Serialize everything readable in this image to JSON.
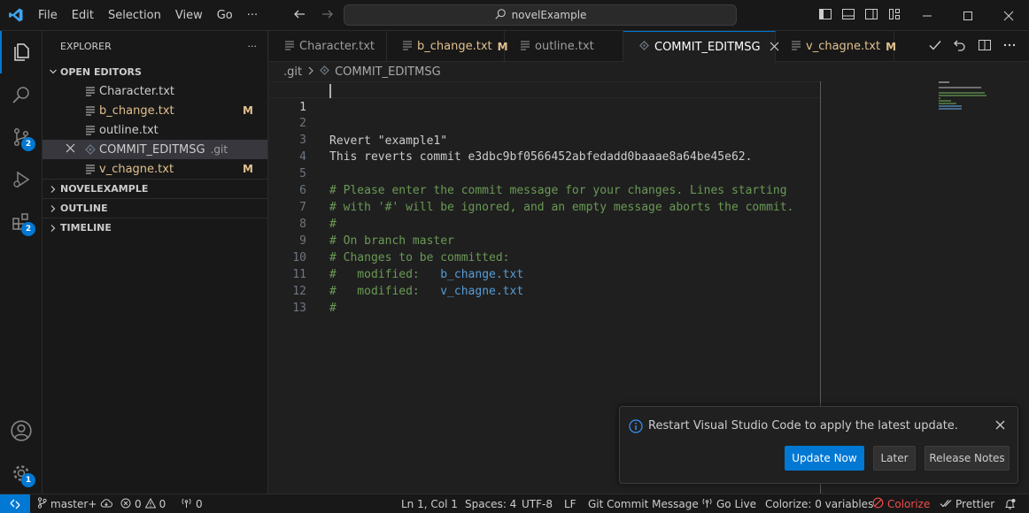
{
  "menu": [
    "File",
    "Edit",
    "Selection",
    "View",
    "Go",
    "···"
  ],
  "search": {
    "text": "novelExample"
  },
  "explorer": {
    "title": "EXPLORER",
    "more": "···",
    "open_editors": {
      "label": "OPEN EDITORS",
      "files": [
        {
          "name": "Character.txt",
          "desc": "",
          "mod": ""
        },
        {
          "name": "b_change.txt",
          "desc": "",
          "mod": "M"
        },
        {
          "name": "outline.txt",
          "desc": "",
          "mod": ""
        },
        {
          "name": "COMMIT_EDITMSG",
          "desc": ".git",
          "mod": ""
        },
        {
          "name": "v_chagne.txt",
          "desc": "",
          "mod": "M"
        }
      ]
    },
    "sections": [
      "NOVELEXAMPLE",
      "OUTLINE",
      "TIMELINE"
    ]
  },
  "activity": {
    "scm_badge": "2",
    "ext_badge": "2",
    "settings_badge": "1"
  },
  "tabs": [
    {
      "label": "Character.txt",
      "mod": ""
    },
    {
      "label": "b_change.txt",
      "mod": "M"
    },
    {
      "label": "outline.txt",
      "mod": ""
    },
    {
      "label": "COMMIT_EDITMSG",
      "mod": ""
    },
    {
      "label": "v_chagne.txt",
      "mod": "M"
    }
  ],
  "breadcrumb": {
    "folder": ".git",
    "file": "COMMIT_EDITMSG"
  },
  "editor": {
    "lines": [
      {
        "n": "1",
        "text": "Revert \"example1\""
      },
      {
        "n": "2",
        "text": ""
      },
      {
        "n": "3",
        "text": "This reverts commit e3dbc9bf0566452abfedadd0baaae8a64be45e62."
      },
      {
        "n": "4",
        "text": ""
      },
      {
        "n": "5",
        "text": "# Please enter the commit message for your changes. Lines starting"
      },
      {
        "n": "6",
        "text": "# with '#' will be ignored, and an empty message aborts the commit."
      },
      {
        "n": "7",
        "text": "#"
      },
      {
        "n": "8",
        "text": "# On branch master"
      },
      {
        "n": "9",
        "text": "# Changes to be committed:"
      },
      {
        "n": "10",
        "text": "#\tmodified:   ",
        "file": "b_change.txt"
      },
      {
        "n": "11",
        "text": "#\tmodified:   ",
        "file": "v_chagne.txt"
      },
      {
        "n": "12",
        "text": "#"
      },
      {
        "n": "13",
        "text": ""
      }
    ]
  },
  "notification": {
    "message": "Restart Visual Studio Code to apply the latest update.",
    "buttons": {
      "update": "Update Now",
      "later": "Later",
      "notes": "Release Notes"
    }
  },
  "status": {
    "branch": "master+",
    "errors": "0",
    "warnings": "0",
    "ports": "0",
    "position": "Ln 1, Col 1",
    "spaces": "Spaces: 4",
    "encoding": "UTF-8",
    "eol": "LF",
    "language": "Git Commit Message",
    "golive": "Go Live",
    "colorize_vars": "Colorize: 0 variables",
    "colorize": "Colorize",
    "prettier": "Prettier"
  },
  "colors": {
    "accent": "#0078d4",
    "modified": "#e2c08d",
    "comment": "#6a9955",
    "link": "#569cd6",
    "error": "#f14c4c"
  }
}
